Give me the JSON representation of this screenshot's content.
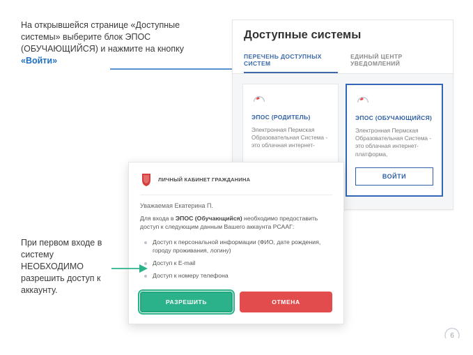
{
  "instructions": {
    "top_prefix": "На открывшейся странице «Доступные системы» выберите блок ЭПОС (ОБУЧАЮЩИЙСЯ) и нажмите на кнопку ",
    "top_highlight": "«Войти»",
    "bottom": "При первом входе в систему НЕОБХОДИМО разрешить доступ к аккаунту."
  },
  "systems_panel": {
    "title": "Доступные системы",
    "tabs": {
      "list": "ПЕРЕЧЕНЬ ДОСТУПНЫХ СИСТЕМ",
      "notifications": "ЕДИНЫЙ ЦЕНТР УВЕДОМЛЕНИЙ"
    },
    "cards": [
      {
        "title": "ЭПОС (РОДИТЕЛЬ)",
        "desc": "Электронная Пермская Образовательная Система - это облачная интернет-",
        "button": ""
      },
      {
        "title": "ЭПОС (ОБУЧАЮЩИЙСЯ)",
        "desc": "Электронная Пермская Образовательная Система - это облачная интернет-платформа,",
        "button": "ВОЙТИ"
      }
    ]
  },
  "modal": {
    "brand": "ЛИЧНЫЙ КАБИНЕТ ГРАЖДАНИНА",
    "greeting": "Уважаемая Екатерина П.",
    "lead_prefix": "Для входа в ",
    "lead_bold": "ЭПОС (Обучающийся)",
    "lead_suffix": " необходимо предоставить доступ к следующим данным Вашего аккаунта РСААГ:",
    "items": [
      "Доступ к персональной информации (ФИО, дате рождения, городу проживания, логину)",
      "Доступ к E-mail",
      "Доступ к номеру телефона"
    ],
    "allow": "РАЗРЕШИТЬ",
    "cancel": "ОТМЕНА"
  },
  "page_number": "6"
}
